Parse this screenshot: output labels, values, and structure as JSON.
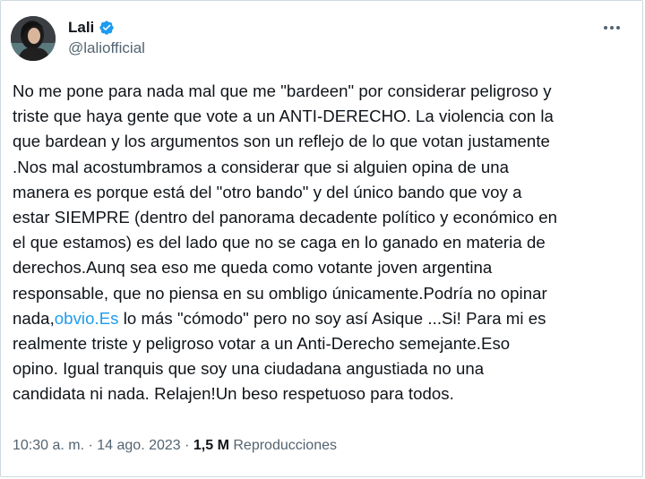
{
  "author": {
    "display_name": "Lali",
    "handle": "@laliofficial",
    "verified_icon": "verified-badge-icon",
    "avatar_icon": "profile-avatar"
  },
  "menu": {
    "more_icon": "more-options-icon"
  },
  "tweet": {
    "lines": [
      [
        "No me pone para nada mal que me \"bardeen\" por considerar peligroso y"
      ],
      [
        "triste que haya gente que vote a un ANTI-DERECHO. La violencia con la"
      ],
      [
        "que bardean y los argumentos son un reflejo de lo que votan justamente"
      ],
      [
        ".Nos mal acostumbramos a considerar que si alguien opina de una"
      ],
      [
        "manera es porque está del \"otro bando\" y del único bando que voy a"
      ],
      [
        "estar SIEMPRE (dentro del panorama decadente político y económico en"
      ],
      [
        "el que estamos) es del lado que no se caga en lo ganado en materia de"
      ],
      [
        "derechos.Aunq sea eso me queda como votante joven argentina"
      ],
      [
        "responsable, que no piensa en su ombligo únicamente.Podría no opinar"
      ],
      [
        "nada,",
        "obvio.Es",
        " lo más \"cómodo\" pero no soy así Asique ...Si! Para mi es"
      ],
      [
        "realmente triste y peligroso votar a un Anti-Derecho semejante.Eso"
      ],
      [
        "opino. Igual tranquis que soy una ciudadana angustiada no una"
      ],
      [
        "candidata ni nada. Relajen!Un beso respetuoso para todos."
      ]
    ],
    "link_text": "obvio.Es"
  },
  "meta": {
    "time": "10:30 a. m.",
    "separator": " · ",
    "date": "14 ago. 2023",
    "views_count": "1,5 M",
    "views_label": "Reproducciones"
  },
  "colors": {
    "link": "#1d9bf0",
    "verified": "#1d9bf0",
    "secondary_text": "#536471",
    "primary_text": "#0f1419"
  }
}
